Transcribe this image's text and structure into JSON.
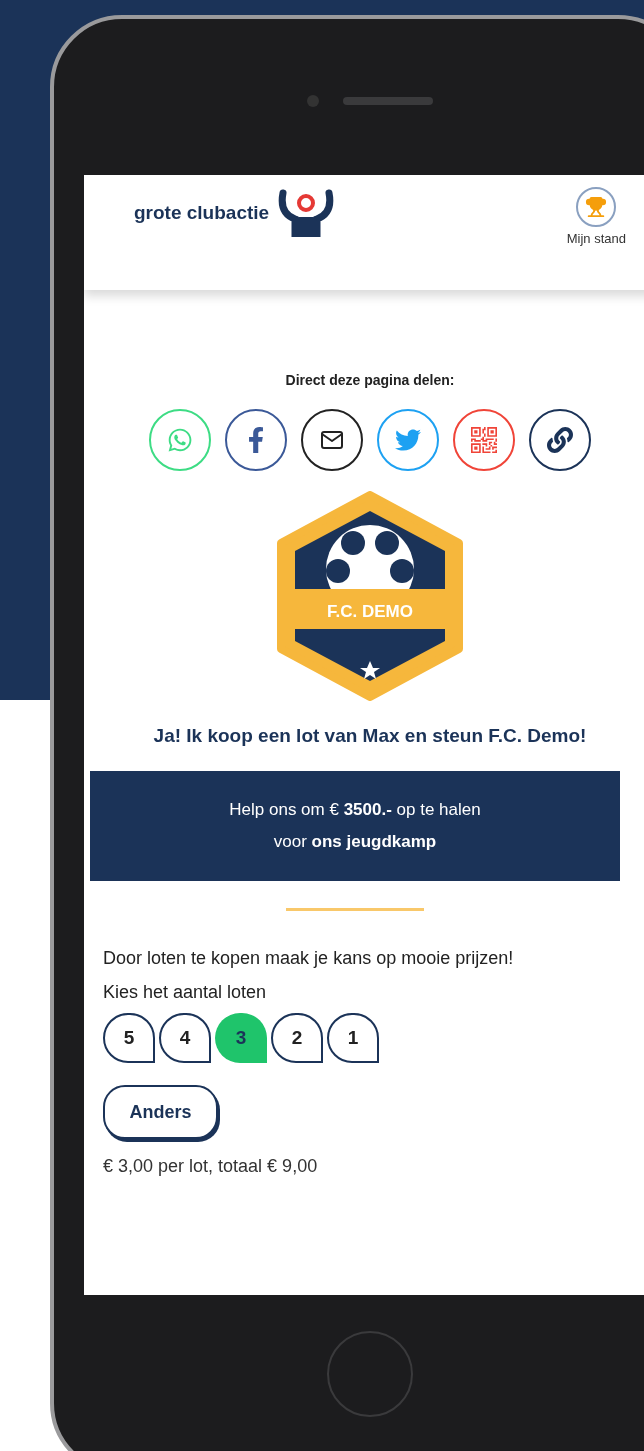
{
  "header": {
    "logo_text": "grote clubactie",
    "link": "Mijn stand"
  },
  "share": {
    "label": "Direct deze pagina delen:",
    "buttons": [
      {
        "kind": "whatsapp",
        "color": "#3ddc84"
      },
      {
        "kind": "facebook",
        "color": "#3b5998"
      },
      {
        "kind": "email",
        "color": "#222222"
      },
      {
        "kind": "twitter",
        "color": "#1da1f2"
      },
      {
        "kind": "qr",
        "color": "#f04438"
      },
      {
        "kind": "link",
        "color": "#1b3358"
      }
    ]
  },
  "club_badge": {
    "name": "F.C. DEMO"
  },
  "title": "Ja! Ik koop een lot van Max en steun F.C. Demo!",
  "banner": {
    "line_1": "Help ons om € **3500.-** op te halen",
    "line_2": "voor **ons jeugdkamp**"
  },
  "intro": "Door loten te kopen maak je kans op mooie prijzen!",
  "choose_label": "Kies het aantal loten",
  "quantities": [
    {
      "label": "5",
      "selected": false
    },
    {
      "label": "4",
      "selected": false
    },
    {
      "label": "3",
      "selected": true
    },
    {
      "label": "2",
      "selected": false
    },
    {
      "label": "1",
      "selected": false
    }
  ],
  "other_button": "Anders",
  "price_text": "€ 3,00 per lot, totaal € 9,00"
}
